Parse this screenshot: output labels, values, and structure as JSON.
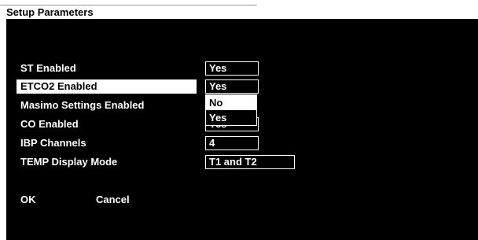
{
  "window": {
    "title": "Setup Parameters"
  },
  "rows": [
    {
      "label": "ST Enabled",
      "value": "Yes"
    },
    {
      "label": "ETCO2 Enabled",
      "value": "Yes"
    },
    {
      "label": "Masimo Settings Enabled",
      "value": ""
    },
    {
      "label": "CO Enabled",
      "value": "Yes"
    },
    {
      "label": "IBP Channels",
      "value": "4"
    },
    {
      "label": "TEMP Display Mode",
      "value": "T1 and T2"
    }
  ],
  "dropdown": {
    "options": [
      "No",
      "Yes"
    ],
    "highlighted": "No"
  },
  "buttons": {
    "ok": "OK",
    "cancel": "Cancel"
  }
}
